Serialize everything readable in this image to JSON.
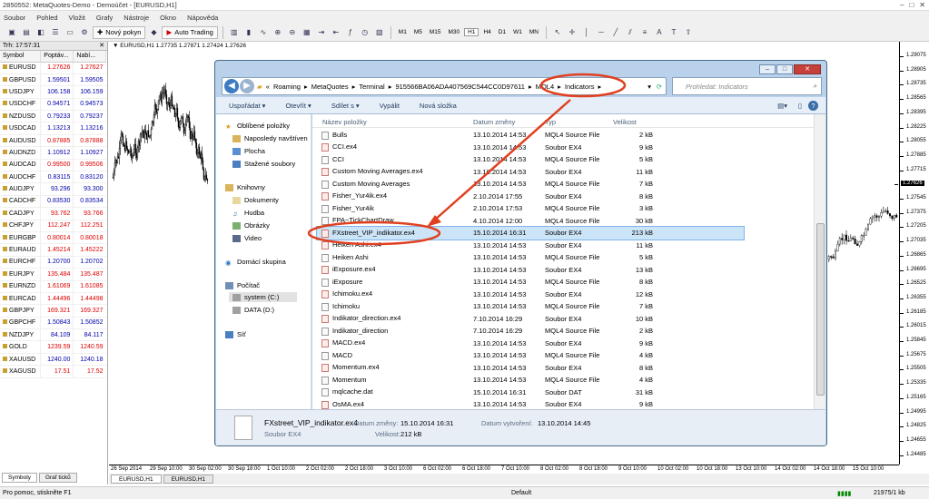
{
  "window_title": "2850552: MetaQuotes-Demo - Demoúčet - [EURUSD,H1]",
  "menu": [
    "Soubor",
    "Pohled",
    "Vložit",
    "Grafy",
    "Nástroje",
    "Okno",
    "Nápověda"
  ],
  "toolbar": {
    "new_order": "Nový pokyn",
    "auto_trading": "Auto Trading",
    "timeframes": [
      "M1",
      "M5",
      "M15",
      "M30",
      "H1",
      "H4",
      "D1",
      "W1",
      "MN"
    ]
  },
  "market_watch": {
    "title": "Trh: 17:57:31",
    "columns": [
      "Symbol",
      "Poptáv...",
      "Nabí..."
    ],
    "rows": [
      {
        "s": "EURUSD",
        "b": "1.27626",
        "a": "1.27627",
        "c": "red"
      },
      {
        "s": "GBPUSD",
        "b": "1.59501",
        "a": "1.59505",
        "c": "blue"
      },
      {
        "s": "USDJPY",
        "b": "106.158",
        "a": "106.159",
        "c": "blue"
      },
      {
        "s": "USDCHF",
        "b": "0.94571",
        "a": "0.94573",
        "c": "blue"
      },
      {
        "s": "NZDUSD",
        "b": "0.79233",
        "a": "0.79237",
        "c": "blue"
      },
      {
        "s": "USDCAD",
        "b": "1.13213",
        "a": "1.13216",
        "c": "blue"
      },
      {
        "s": "AUDUSD",
        "b": "0.87885",
        "a": "0.87888",
        "c": "red"
      },
      {
        "s": "AUDNZD",
        "b": "1.10912",
        "a": "1.10927",
        "c": "blue"
      },
      {
        "s": "AUDCAD",
        "b": "0.99500",
        "a": "0.99506",
        "c": "red"
      },
      {
        "s": "AUDCHF",
        "b": "0.83115",
        "a": "0.83120",
        "c": "blue"
      },
      {
        "s": "AUDJPY",
        "b": "93.296",
        "a": "93.300",
        "c": "blue"
      },
      {
        "s": "CADCHF",
        "b": "0.83530",
        "a": "0.83534",
        "c": "blue"
      },
      {
        "s": "CADJPY",
        "b": "93.762",
        "a": "93.766",
        "c": "red"
      },
      {
        "s": "CHFJPY",
        "b": "112.247",
        "a": "112.251",
        "c": "red"
      },
      {
        "s": "EURGBP",
        "b": "0.80014",
        "a": "0.80018",
        "c": "red"
      },
      {
        "s": "EURAUD",
        "b": "1.45214",
        "a": "1.45222",
        "c": "red"
      },
      {
        "s": "EURCHF",
        "b": "1.20700",
        "a": "1.20702",
        "c": "blue"
      },
      {
        "s": "EURJPY",
        "b": "135.484",
        "a": "135.487",
        "c": "red"
      },
      {
        "s": "EURNZD",
        "b": "1.61069",
        "a": "1.61085",
        "c": "red"
      },
      {
        "s": "EURCAD",
        "b": "1.44496",
        "a": "1.44498",
        "c": "red"
      },
      {
        "s": "GBPJPY",
        "b": "169.321",
        "a": "169.327",
        "c": "red"
      },
      {
        "s": "GBPCHF",
        "b": "1.50843",
        "a": "1.50852",
        "c": "blue"
      },
      {
        "s": "NZDJPY",
        "b": "84.109",
        "a": "84.117",
        "c": "blue"
      },
      {
        "s": "GOLD",
        "b": "1239.59",
        "a": "1240.59",
        "c": "red"
      },
      {
        "s": "XAUUSD",
        "b": "1240.00",
        "a": "1240.18",
        "c": "blue"
      },
      {
        "s": "XAGUSD",
        "b": "17.51",
        "a": "17.52",
        "c": "red"
      }
    ],
    "tabs": [
      "Symboly",
      "Graf ticků"
    ]
  },
  "chart": {
    "label": "EURUSD,H1  1.27735 1.27871 1.27424 1.27626",
    "price_labels": [
      "1.29075",
      "1.28905",
      "1.28735",
      "1.28565",
      "1.28395",
      "1.28225",
      "1.28055",
      "1.27885",
      "1.27715",
      "1.27626",
      "1.27545",
      "1.27375",
      "1.27205",
      "1.27035",
      "1.26865",
      "1.26695",
      "1.26525",
      "1.26355",
      "1.26185",
      "1.26015",
      "1.25845",
      "1.25675",
      "1.25505",
      "1.25335",
      "1.25165",
      "1.24995",
      "1.24825",
      "1.24655",
      "1.24485"
    ],
    "current_price": "1.27626",
    "time_labels": [
      "26 Sep 2014",
      "29 Sep 10:00",
      "30 Sep 02:00",
      "30 Sep 18:00",
      "1 Oct 10:00",
      "2 Oct 02:00",
      "2 Oct 18:00",
      "3 Oct 10:00",
      "6 Oct 02:00",
      "6 Oct 18:00",
      "7 Oct 10:00",
      "8 Oct 02:00",
      "8 Oct 18:00",
      "9 Oct 10:00",
      "10 Oct 02:00",
      "10 Oct 18:00",
      "13 Oct 10:00",
      "14 Oct 02:00",
      "14 Oct 18:00",
      "15 Oct 10:00"
    ],
    "tabs": [
      "EURUSD,H1",
      "EURUSD,H1"
    ]
  },
  "explorer": {
    "path": [
      "«",
      "Roaming",
      "MetaQuotes",
      "Terminal",
      "915566BA06ADA407569C544CC0D97611",
      "MQL4",
      "Indicators"
    ],
    "search_placeholder": "Prohledat: Indicators",
    "commands": [
      "Uspořádat ▾",
      "Otevřít ▾",
      "Sdílet s ▾",
      "Vypálit",
      "Nová složka"
    ],
    "nav": {
      "favorites": "Oblíbené položky",
      "fav_items": [
        "Naposledy navštíven",
        "Plocha",
        "Stažené soubory"
      ],
      "libraries": "Knihovny",
      "lib_items": [
        "Dokumenty",
        "Hudba",
        "Obrázky",
        "Video"
      ],
      "homegroup": "Domácí skupina",
      "computer": "Počítač",
      "comp_items": [
        "system (C:)",
        "DATA (D:)"
      ],
      "network": "Síť"
    },
    "columns": [
      "Název položky",
      "Datum změny",
      "Typ",
      "Velikost"
    ],
    "files": [
      {
        "n": "Bulls",
        "d": "13.10.2014 14:53",
        "t": "MQL4 Source File",
        "s": "2 kB",
        "ex": false
      },
      {
        "n": "CCI.ex4",
        "d": "13.10.2014 14:53",
        "t": "Soubor EX4",
        "s": "9 kB",
        "ex": true
      },
      {
        "n": "CCI",
        "d": "13.10.2014 14:53",
        "t": "MQL4 Source File",
        "s": "5 kB",
        "ex": false
      },
      {
        "n": "Custom Moving Averages.ex4",
        "d": "13.10.2014 14:53",
        "t": "Soubor EX4",
        "s": "11 kB",
        "ex": true
      },
      {
        "n": "Custom Moving Averages",
        "d": "13.10.2014 14:53",
        "t": "MQL4 Source File",
        "s": "7 kB",
        "ex": false
      },
      {
        "n": "Fisher_Yur4ik.ex4",
        "d": "2.10.2014 17:55",
        "t": "Soubor EX4",
        "s": "8 kB",
        "ex": true
      },
      {
        "n": "Fisher_Yur4ik",
        "d": "2.10.2014 17:53",
        "t": "MQL4 Source File",
        "s": "3 kB",
        "ex": false
      },
      {
        "n": "FPA~TickChartDraw",
        "d": "4.10.2014 12:00",
        "t": "MQL4 Source File",
        "s": "30 kB",
        "ex": false
      },
      {
        "n": "FXstreet_VIP_indikator.ex4",
        "d": "15.10.2014 16:31",
        "t": "Soubor EX4",
        "s": "213 kB",
        "ex": true,
        "sel": true
      },
      {
        "n": "Heiken Ashi.ex4",
        "d": "13.10.2014 14:53",
        "t": "Soubor EX4",
        "s": "11 kB",
        "ex": true
      },
      {
        "n": "Heiken Ashi",
        "d": "13.10.2014 14:53",
        "t": "MQL4 Source File",
        "s": "5 kB",
        "ex": false
      },
      {
        "n": "iExposure.ex4",
        "d": "13.10.2014 14:53",
        "t": "Soubor EX4",
        "s": "13 kB",
        "ex": true
      },
      {
        "n": "iExposure",
        "d": "13.10.2014 14:53",
        "t": "MQL4 Source File",
        "s": "8 kB",
        "ex": false
      },
      {
        "n": "Ichimoku.ex4",
        "d": "13.10.2014 14:53",
        "t": "Soubor EX4",
        "s": "12 kB",
        "ex": true
      },
      {
        "n": "Ichimoku",
        "d": "13.10.2014 14:53",
        "t": "MQL4 Source File",
        "s": "7 kB",
        "ex": false
      },
      {
        "n": "Indikator_direction.ex4",
        "d": "7.10.2014 16:29",
        "t": "Soubor EX4",
        "s": "10 kB",
        "ex": true
      },
      {
        "n": "Indikator_direction",
        "d": "7.10.2014 16:29",
        "t": "MQL4 Source File",
        "s": "2 kB",
        "ex": false
      },
      {
        "n": "MACD.ex4",
        "d": "13.10.2014 14:53",
        "t": "Soubor EX4",
        "s": "9 kB",
        "ex": true
      },
      {
        "n": "MACD",
        "d": "13.10.2014 14:53",
        "t": "MQL4 Source File",
        "s": "4 kB",
        "ex": false
      },
      {
        "n": "Momentum.ex4",
        "d": "13.10.2014 14:53",
        "t": "Soubor EX4",
        "s": "8 kB",
        "ex": true
      },
      {
        "n": "Momentum",
        "d": "13.10.2014 14:53",
        "t": "MQL4 Source File",
        "s": "4 kB",
        "ex": false
      },
      {
        "n": "mqlcache.dat",
        "d": "15.10.2014 16:31",
        "t": "Soubor DAT",
        "s": "31 kB",
        "ex": false
      },
      {
        "n": "OsMA.ex4",
        "d": "13.10.2014 14:53",
        "t": "Soubor EX4",
        "s": "9 kB",
        "ex": true
      }
    ],
    "details": {
      "name": "FXstreet_VIP_indikator.ex4",
      "modified_label": "Datum změny:",
      "modified": "15.10.2014 16:31",
      "created_label": "Datum vytvoření:",
      "created": "13.10.2014 14:45",
      "type": "Soubor EX4",
      "size_label": "Velikost:",
      "size": "212 kB"
    }
  },
  "status": {
    "help": "Pro pomoc, stiskněte F1",
    "profile": "Default",
    "traffic": "21975/1 kb"
  },
  "colors": {
    "annotation": "#e04020",
    "selected_row": "#cce4f7",
    "bull": "#000",
    "bear": "#000"
  }
}
